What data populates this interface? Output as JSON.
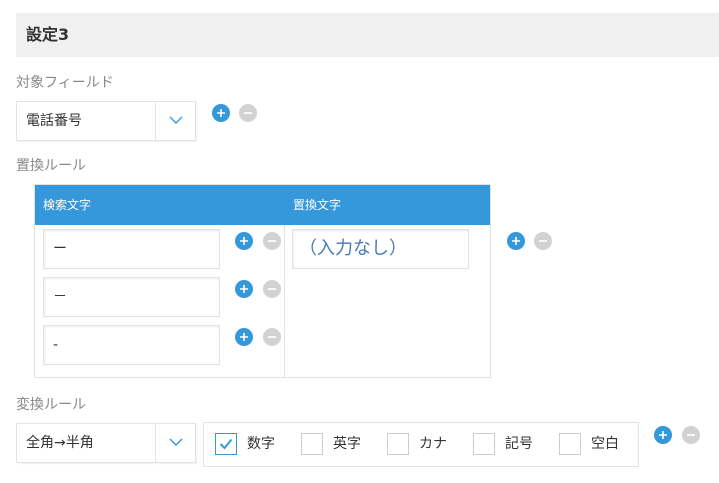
{
  "section": {
    "title": "設定3"
  },
  "target_field": {
    "label": "対象フィールド",
    "selected": "電話番号"
  },
  "replace_rule": {
    "label": "置換ルール",
    "columns": {
      "search": "検索文字",
      "replace": "置換文字"
    },
    "search_values": [
      "ー",
      "－",
      "-"
    ],
    "replace_value": "（入力なし）"
  },
  "convert_rule": {
    "label": "変換ルール",
    "selected": "全角→半角",
    "options": [
      {
        "label": "数字",
        "checked": true
      },
      {
        "label": "英字",
        "checked": false
      },
      {
        "label": "カナ",
        "checked": false
      },
      {
        "label": "記号",
        "checked": false
      },
      {
        "label": "空白",
        "checked": false
      }
    ]
  },
  "colors": {
    "accent": "#3498db",
    "remove": "#d2d2d2",
    "header_bg": "#f0f0f0"
  }
}
